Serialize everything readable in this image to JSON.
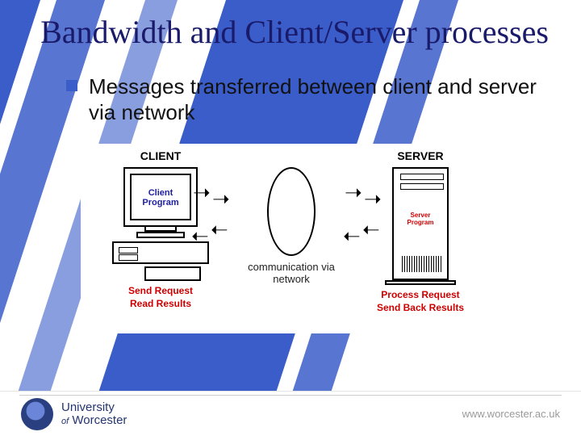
{
  "title": "Bandwidth and Client/Server processes",
  "bullet": "Messages transferred between client and server via network",
  "diagram": {
    "client_label": "CLIENT",
    "server_label": "SERVER",
    "client_program": "Client Program",
    "server_program": "Server Program",
    "comm_text": "communication via network",
    "client_caption_1": "Send Request",
    "client_caption_2": "Read Results",
    "server_caption_1": "Process Request",
    "server_caption_2": "Send Back Results"
  },
  "footer": {
    "uni_line1": "University",
    "uni_of": "of",
    "uni_line2": "Worcester",
    "url": "www.worcester.ac.uk"
  }
}
